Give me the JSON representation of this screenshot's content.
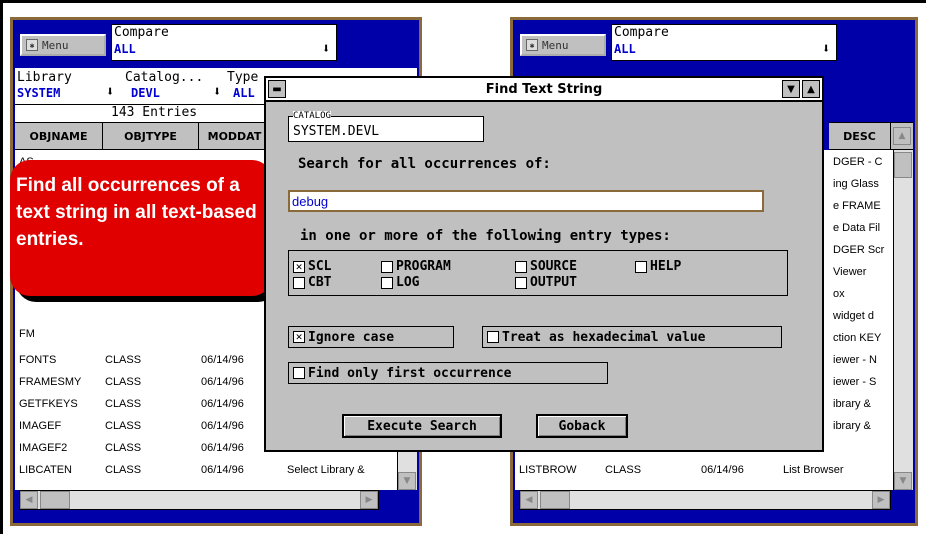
{
  "left_window": {
    "menu_label": "Menu",
    "compare_label": "Compare",
    "compare_value": "ALL",
    "library_label": "Library",
    "library_value": "SYSTEM",
    "catalog_label": "Catalog...",
    "catalog_value": "DEVL",
    "type_label": "Type",
    "type_value": "ALL",
    "entries": "143 Entries",
    "columns": [
      "OBJNAME",
      "OBJTYPE",
      "MODDAT"
    ],
    "rows": [
      {
        "name": "FONTS",
        "type": "CLASS",
        "date": "06/14/96",
        "desc": ""
      },
      {
        "name": "FRAMESMY",
        "type": "CLASS",
        "date": "06/14/96",
        "desc": ""
      },
      {
        "name": "GETFKEYS",
        "type": "CLASS",
        "date": "06/14/96",
        "desc": ""
      },
      {
        "name": "IMAGEF",
        "type": "CLASS",
        "date": "06/14/96",
        "desc": ""
      },
      {
        "name": "IMAGEF2",
        "type": "CLASS",
        "date": "06/14/96",
        "desc": ""
      },
      {
        "name": "LIBCATEN",
        "type": "CLASS",
        "date": "06/14/96",
        "desc": "Select Library &"
      }
    ],
    "partial_top": "AS",
    "partial_fm": "FM"
  },
  "right_window": {
    "menu_label": "Menu",
    "compare_label": "Compare",
    "compare_value": "ALL",
    "desc_header": "DESC",
    "desc_rows": [
      "DGER - C",
      "ing Glass",
      "e FRAME",
      "e Data Fil",
      "DGER Scr",
      "Viewer",
      "ox",
      "widget d",
      "ction KEY",
      "iewer - N",
      "iewer - S",
      "ibrary & ",
      "ibrary & "
    ],
    "last_row": {
      "name": "LISTBROW",
      "type": "CLASS",
      "date": "06/14/96",
      "desc": "List Browser"
    }
  },
  "callout": {
    "text": "Find all occurrences of a text string in all text-based entries."
  },
  "dialog": {
    "title": "Find Text String",
    "catalog_label": "CATALOG",
    "catalog_value": "SYSTEM.DEVL",
    "search_prompt": "Search for all occurrences of:",
    "search_value": "debug",
    "types_prompt": "in one or more of the following entry types:",
    "types": [
      {
        "label": "SCL",
        "checked": true
      },
      {
        "label": "PROGRAM",
        "checked": false
      },
      {
        "label": "SOURCE",
        "checked": false
      },
      {
        "label": "HELP",
        "checked": false
      },
      {
        "label": "CBT",
        "checked": false
      },
      {
        "label": "LOG",
        "checked": false
      },
      {
        "label": "OUTPUT",
        "checked": false
      }
    ],
    "ignore_case": "Ignore case",
    "hex": "Treat as hexadecimal value",
    "first_only": "Find only first occurrence",
    "execute": "Execute Search",
    "goback": "Goback"
  }
}
